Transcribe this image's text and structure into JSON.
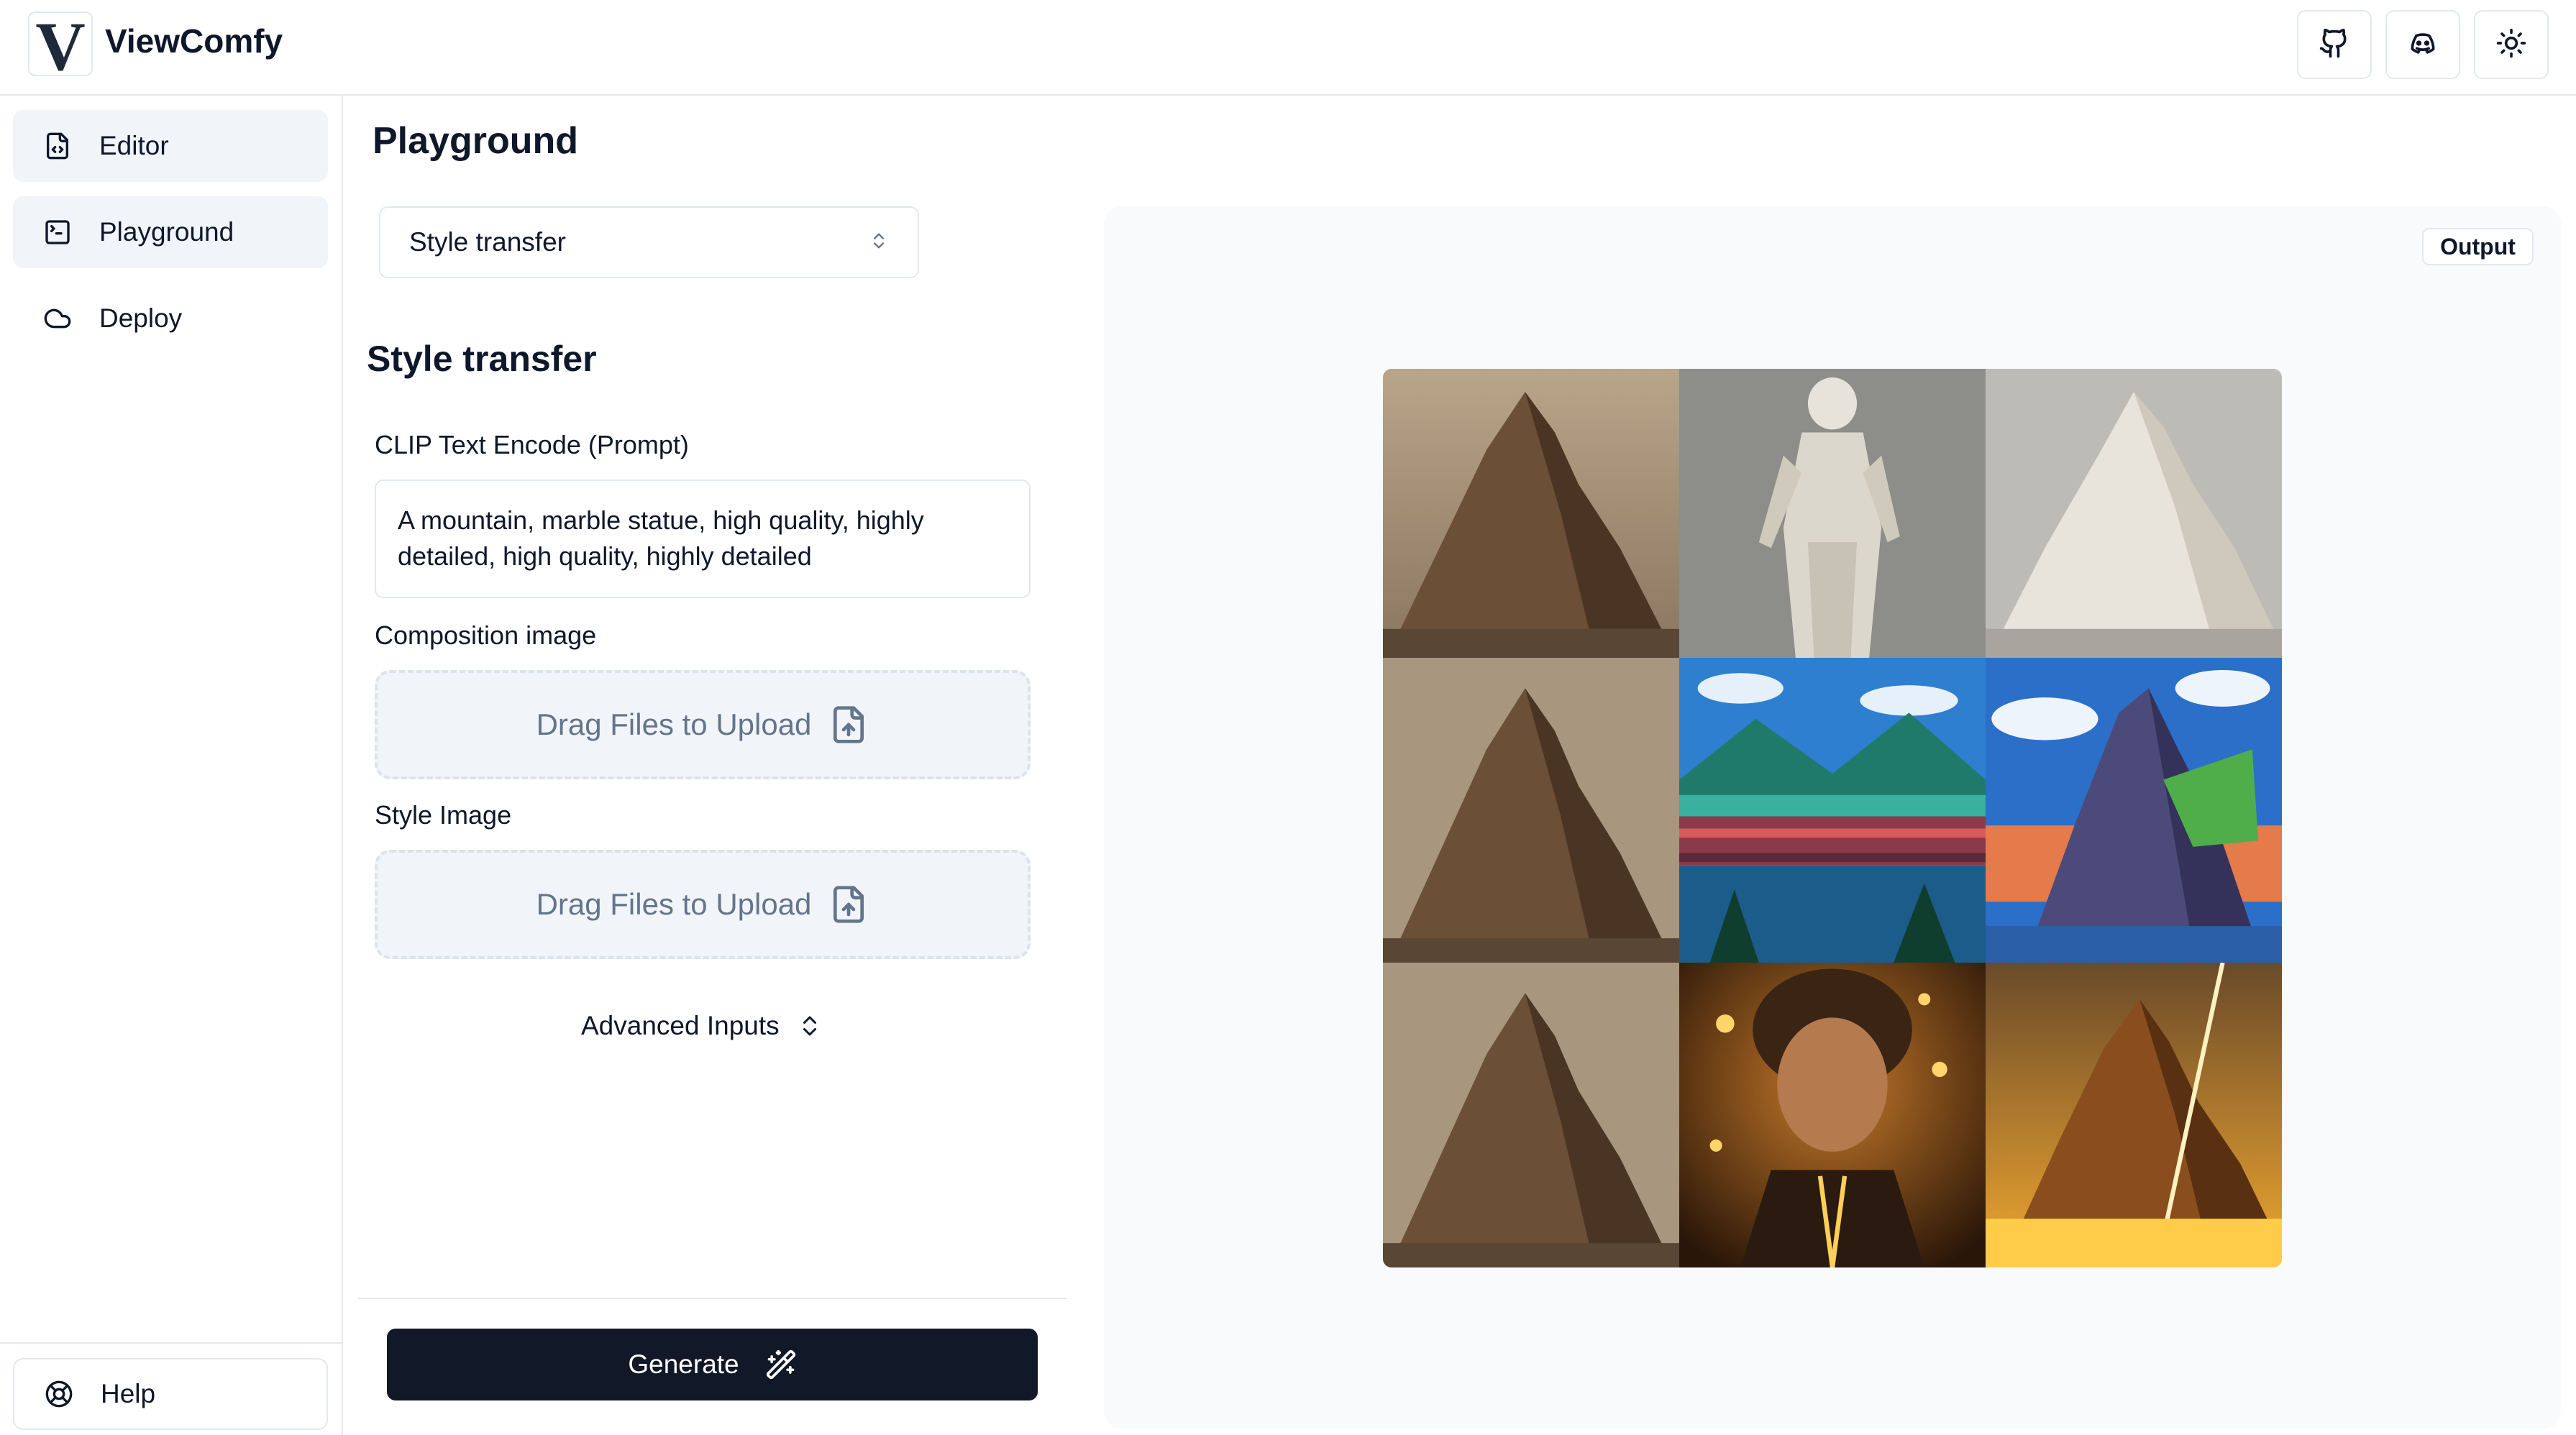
{
  "app": {
    "name": "ViewComfy",
    "logo_letter": "V"
  },
  "topbar": {
    "buttons": [
      {
        "icon": "github-icon"
      },
      {
        "icon": "discord-icon"
      },
      {
        "icon": "sun-icon"
      }
    ]
  },
  "sidebar": {
    "items": [
      {
        "label": "Editor",
        "icon": "file-code-icon",
        "active": true
      },
      {
        "label": "Playground",
        "icon": "terminal-square-icon",
        "active": true
      },
      {
        "label": "Deploy",
        "icon": "cloud-icon",
        "active": false
      }
    ],
    "help": {
      "label": "Help",
      "icon": "life-buoy-icon"
    }
  },
  "main": {
    "page_title": "Playground",
    "workflow_select": {
      "value": "Style transfer",
      "icon": "chevrons-up-down-icon"
    },
    "section_title": "Style transfer",
    "fields": {
      "prompt": {
        "label": "CLIP Text Encode (Prompt)",
        "value": "A mountain, marble statue, high quality, highly detailed, high quality, highly detailed"
      },
      "composition": {
        "label": "Composition image",
        "dropzone_text": "Drag Files to Upload"
      },
      "style": {
        "label": "Style Image",
        "dropzone_text": "Drag Files to Upload"
      }
    },
    "advanced": {
      "label": "Advanced Inputs"
    },
    "generate": {
      "label": "Generate",
      "icon": "wand-sparkles-icon"
    }
  },
  "output": {
    "badge": "Output",
    "images": [
      "mountain",
      "marble-statue",
      "marble-mountain",
      "mountain",
      "pixel-art-bridge",
      "pixel-art-mountain",
      "mountain",
      "golden-portrait",
      "golden-mountain"
    ]
  },
  "colors": {
    "primary": "#111827",
    "panel": "#f8fafc",
    "active_nav": "#f1f5f9",
    "border": "#e2e8f0"
  }
}
